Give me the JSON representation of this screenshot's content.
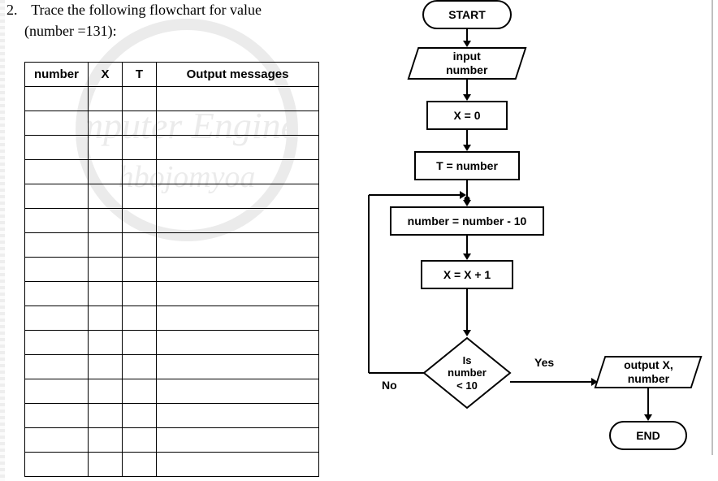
{
  "question": {
    "number": "2.",
    "text": "Trace the following flowchart for value",
    "subline": "(number =131):"
  },
  "table": {
    "headers": {
      "number": "number",
      "x": "X",
      "t": "T",
      "out": "Output messages"
    },
    "blank_rows": 16
  },
  "flow": {
    "start": "START",
    "input": "input\nnumber",
    "x0": "X = 0",
    "tnum": "T = number",
    "dec10": "number = number - 10",
    "xinc": "X = X + 1",
    "decision": "Is\nnumber\n< 10",
    "yes": "Yes",
    "no": "No",
    "output": "output X,\nnumber",
    "end": "END"
  },
  "watermark": {
    "line1": "mputer Engine",
    "line2": "hbojomyoa"
  }
}
